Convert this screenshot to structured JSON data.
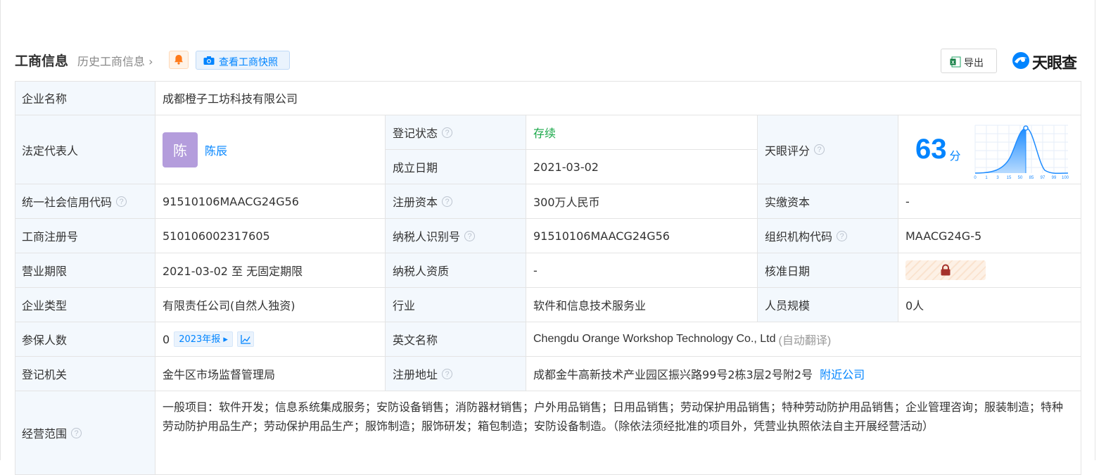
{
  "header": {
    "title": "工商信息",
    "history": "历史工商信息",
    "snapshot_label": "查看工商快照",
    "export_label": "导出",
    "logo_text": "天眼查"
  },
  "colors": {
    "accent": "#0084ff",
    "label_bg": "#f3f8fd",
    "status_green": "#1aa849",
    "avatar_bg": "#b49ddc"
  },
  "rows": {
    "company_name": {
      "label": "企业名称",
      "value": "成都橙子工坊科技有限公司"
    },
    "legal_rep": {
      "label": "法定代表人",
      "avatar_char": "陈",
      "name": "陈辰"
    },
    "reg_status": {
      "label": "登记状态",
      "value": "存续"
    },
    "found_date": {
      "label": "成立日期",
      "value": "2021-03-02"
    },
    "score": {
      "label": "天眼评分",
      "value": "63",
      "unit": "分"
    },
    "credit_code": {
      "label": "统一社会信用代码",
      "value": "91510106MAACG24G56"
    },
    "reg_capital": {
      "label": "注册资本",
      "value": "300万人民币"
    },
    "paid_capital": {
      "label": "实缴资本",
      "value": "-"
    },
    "biz_reg_no": {
      "label": "工商注册号",
      "value": "510106002317605"
    },
    "taxpayer_id": {
      "label": "纳税人识别号",
      "value": "91510106MAACG24G56"
    },
    "org_code": {
      "label": "组织机构代码",
      "value": "MAACG24G-5"
    },
    "biz_term": {
      "label": "营业期限",
      "value": "2021-03-02 至 无固定期限"
    },
    "tax_qual": {
      "label": "纳税人资质",
      "value": "-"
    },
    "approval_date": {
      "label": "核准日期"
    },
    "company_type": {
      "label": "企业类型",
      "value": "有限责任公司(自然人独资)"
    },
    "industry": {
      "label": "行业",
      "value": "软件和信息技术服务业"
    },
    "staff_size": {
      "label": "人员规模",
      "value": "0人"
    },
    "insured": {
      "label": "参保人数",
      "value": "0",
      "report": "2023年报"
    },
    "english_name": {
      "label": "英文名称",
      "value": "Chengdu Orange Workshop Technology Co., Ltd",
      "note": "(自动翻译)"
    },
    "reg_authority": {
      "label": "登记机关",
      "value": "金牛区市场监督管理局"
    },
    "reg_address": {
      "label": "注册地址",
      "value": "成都金牛高新技术产业园区振兴路99号2栋3层2号附2号",
      "nearby": "附近公司"
    },
    "biz_scope": {
      "label": "经营范围",
      "value": "一般项目：软件开发；信息系统集成服务；安防设备销售；消防器材销售；户外用品销售；日用品销售；劳动保护用品销售；特种劳动防护用品销售；企业管理咨询；服装制造；特种劳动防护用品生产；劳动保护用品生产；服饰制造；服饰研发；箱包制造；安防设备制造。（除依法须经批准的项目外，凭营业执照依法自主开展经营活动）"
    }
  },
  "score_chart": {
    "ticks": [
      "0",
      "1",
      "3",
      "15",
      "50",
      "85",
      "97",
      "99",
      "100"
    ]
  }
}
